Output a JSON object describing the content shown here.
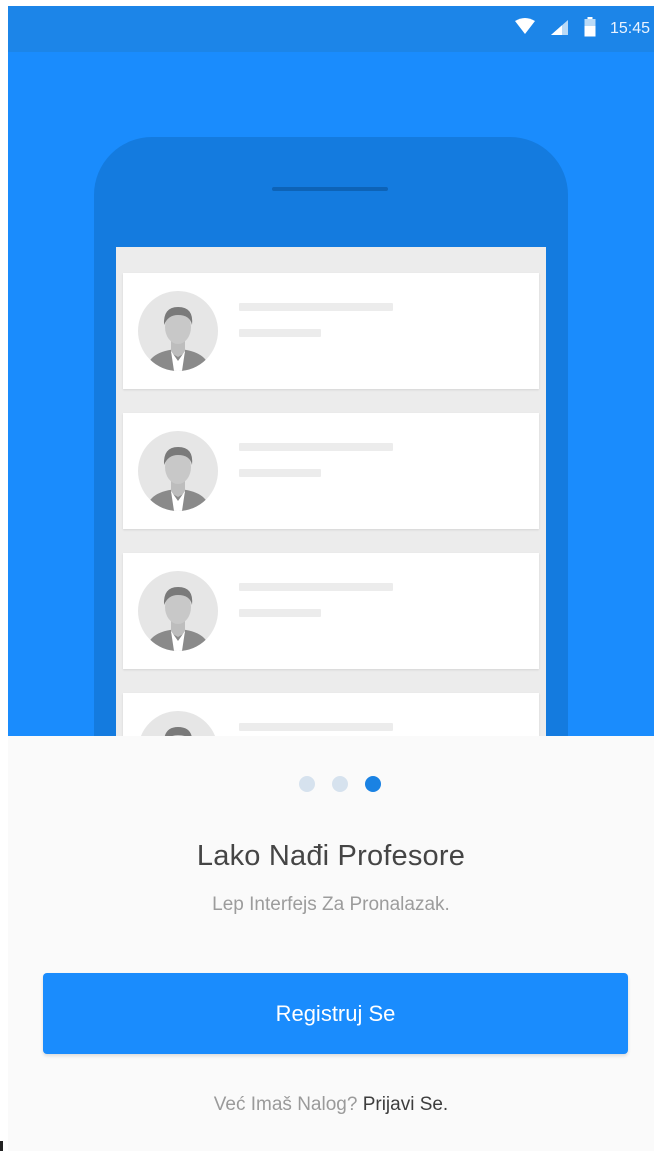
{
  "status_bar": {
    "time": "15:45",
    "icons": [
      "wifi-icon",
      "cell-signal-icon",
      "battery-icon"
    ],
    "color": "#1c85e8"
  },
  "hero": {
    "background": "#1a8cfd",
    "phone_color": "#147bdf",
    "list_items": [
      {
        "avatar": "person-avatar"
      },
      {
        "avatar": "person-avatar"
      },
      {
        "avatar": "person-avatar"
      },
      {
        "avatar": "person-avatar"
      }
    ]
  },
  "pager": {
    "count": 3,
    "active_index": 2,
    "active_color": "#1a82e3"
  },
  "onboarding": {
    "title": "Lako Nađi Profesore",
    "subtitle": "Lep Interfejs Za Pronalazak."
  },
  "actions": {
    "register_label": "Registruj Se",
    "login_prompt": "Već Imaš Nalog?",
    "login_link": "Prijavi Se."
  }
}
